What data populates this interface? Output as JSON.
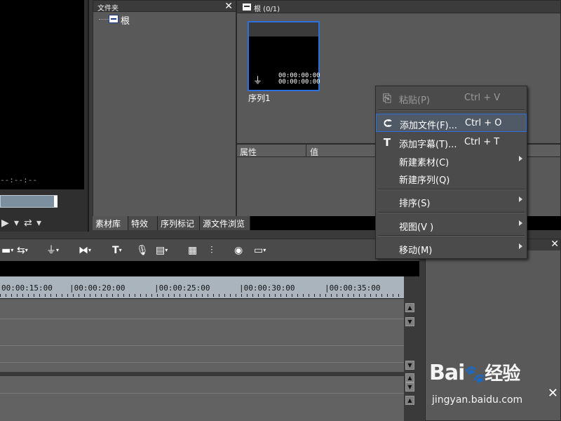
{
  "player": {
    "timecode": "--:--:--",
    "controls": [
      "▶",
      "⇄"
    ]
  },
  "folder_panel": {
    "title": "文件夹",
    "close_glyph": "✕",
    "tree": [
      {
        "label": "根"
      }
    ]
  },
  "bin_panel": {
    "title": "根 (0/1)",
    "items": [
      {
        "caption": "序列1",
        "timecode_in": "00:00:00:00",
        "timecode_out": "00:00:00:00"
      }
    ]
  },
  "properties": {
    "col_property": "属性",
    "col_value": "值"
  },
  "tabs": [
    {
      "label": "素材库",
      "active": true
    },
    {
      "label": "特效",
      "active": false
    },
    {
      "label": "序列标记",
      "active": false
    },
    {
      "label": "源文件浏览",
      "active": false
    }
  ],
  "timeline": {
    "ruler_labels": [
      "00:00:15:00",
      "|00:00:20:00",
      "|00:00:25:00",
      "|00:00:30:00",
      "|00:00:35:00"
    ]
  },
  "context_menu": {
    "items": [
      {
        "label": "粘贴(P)",
        "shortcut": "Ctrl + V",
        "icon": "paste-icon",
        "disabled": true
      },
      {
        "label": "添加文件(F)...",
        "shortcut": "Ctrl + O",
        "icon": "add-file-icon",
        "highlighted": true
      },
      {
        "label": "添加字幕(T)...",
        "shortcut": "Ctrl + T",
        "icon": "title-t-icon"
      },
      {
        "label": "新建素材(C)",
        "shortcut": "",
        "submenu": true
      },
      {
        "label": "新建序列(Q)",
        "shortcut": ""
      },
      {
        "label": "排序(S)",
        "shortcut": "",
        "submenu": true
      },
      {
        "label": "视图(V )",
        "shortcut": "",
        "submenu": true
      },
      {
        "label": "移动(M)",
        "shortcut": "",
        "submenu": true
      }
    ]
  },
  "watermark": {
    "brand_left": "Bai",
    "brand_right": "经验",
    "url": "jingyan.baidu.com"
  },
  "colors": {
    "selection_blue": "#2e6fdb",
    "panel_bg": "#595959",
    "ruler_bg": "#aab4bc"
  }
}
